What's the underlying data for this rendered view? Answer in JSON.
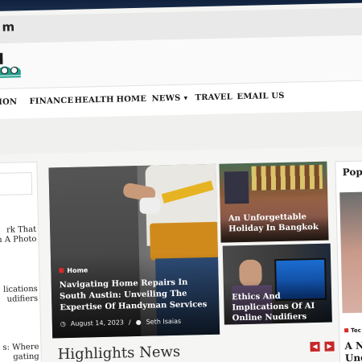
{
  "browser": {
    "url_fragment": "m"
  },
  "nav": {
    "items": [
      {
        "label": "TION"
      },
      {
        "label": "FINANCE"
      },
      {
        "label": "HEALTH"
      },
      {
        "label": "HOME"
      },
      {
        "label": "NEWS"
      },
      {
        "label": "TRAVEL"
      },
      {
        "label": "EMAIL US"
      }
    ]
  },
  "sidebar": {
    "items": [
      {
        "text": "rk That\nn A Photo"
      },
      {
        "text": "lications\nudifiers"
      },
      {
        "text": "s: Where\ngating\nold Rates"
      }
    ]
  },
  "hero": {
    "category": "Home",
    "title": "Navigating Home Repairs In South Austin: Unveiling The Expertise Of Handyman Services",
    "date": "August 14, 2023",
    "author": "Seth Isaias"
  },
  "cards": [
    {
      "title": "An Unforgettable Holiday In Bangkok"
    },
    {
      "title": "Ethics And Implications Of AI Online Nudifiers"
    }
  ],
  "popular": {
    "title": "Popu",
    "tag": "Tec",
    "headline": "A Ne\nUnd"
  },
  "highlights": {
    "title": "Highlights News"
  },
  "colors": {
    "accent": "#d62b2b",
    "nav_text": "#1b1b1b",
    "logo_teal": "#1f9e8e"
  }
}
